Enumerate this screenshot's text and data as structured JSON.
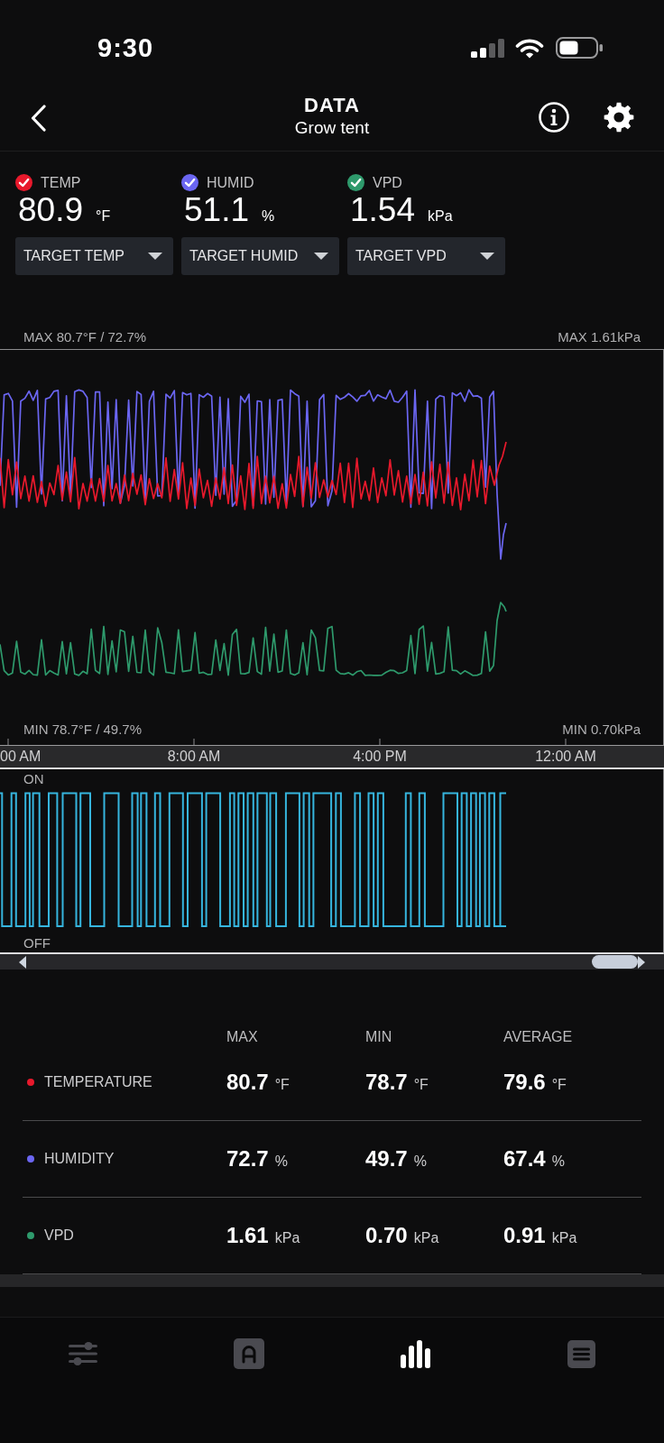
{
  "status_bar": {
    "time": "9:30"
  },
  "header": {
    "title": "DATA",
    "subtitle": "Grow tent"
  },
  "sensors": [
    {
      "label": "TEMP",
      "value": "80.9",
      "unit": "°F",
      "checked": true,
      "color": "#e8192c"
    },
    {
      "label": "HUMID",
      "value": "51.1",
      "unit": "%",
      "checked": true,
      "color": "#6b66f2"
    },
    {
      "label": "VPD",
      "value": "1.54",
      "unit": "kPa",
      "checked": true,
      "color": "#2e9a6c"
    }
  ],
  "targets": [
    {
      "label": "TARGET TEMP"
    },
    {
      "label": "TARGET HUMID"
    },
    {
      "label": "TARGET VPD"
    }
  ],
  "trend_chart": {
    "max_left": "MAX 80.7°F / 72.7%",
    "max_right": "MAX 1.61kPa",
    "min_left": "MIN 78.7°F / 49.7%",
    "min_right": "MIN 0.70kPa",
    "x_labels": [
      "00 AM",
      "8:00 AM",
      "4:00 PM",
      "12:00 AM"
    ]
  },
  "switch_chart": {
    "on_label": "ON",
    "off_label": "OFF"
  },
  "stats": {
    "columns": [
      "MAX",
      "MIN",
      "AVERAGE"
    ],
    "rows": [
      {
        "name": "TEMPERATURE",
        "color": "#e8192c",
        "cells": [
          {
            "value": "80.7",
            "unit": "°F"
          },
          {
            "value": "78.7",
            "unit": "°F"
          },
          {
            "value": "79.6",
            "unit": "°F"
          }
        ]
      },
      {
        "name": "HUMIDITY",
        "color": "#6b66f2",
        "cells": [
          {
            "value": "72.7",
            "unit": "%"
          },
          {
            "value": "49.7",
            "unit": "%"
          },
          {
            "value": "67.4",
            "unit": "%"
          }
        ]
      },
      {
        "name": "VPD",
        "color": "#2e9a6c",
        "cells": [
          {
            "value": "1.61",
            "unit": "kPa"
          },
          {
            "value": "0.70",
            "unit": "kPa"
          },
          {
            "value": "0.91",
            "unit": "kPa"
          }
        ]
      }
    ]
  },
  "nav": [
    {
      "selected": false
    },
    {
      "selected": false
    },
    {
      "selected": true
    },
    {
      "selected": false
    }
  ]
}
